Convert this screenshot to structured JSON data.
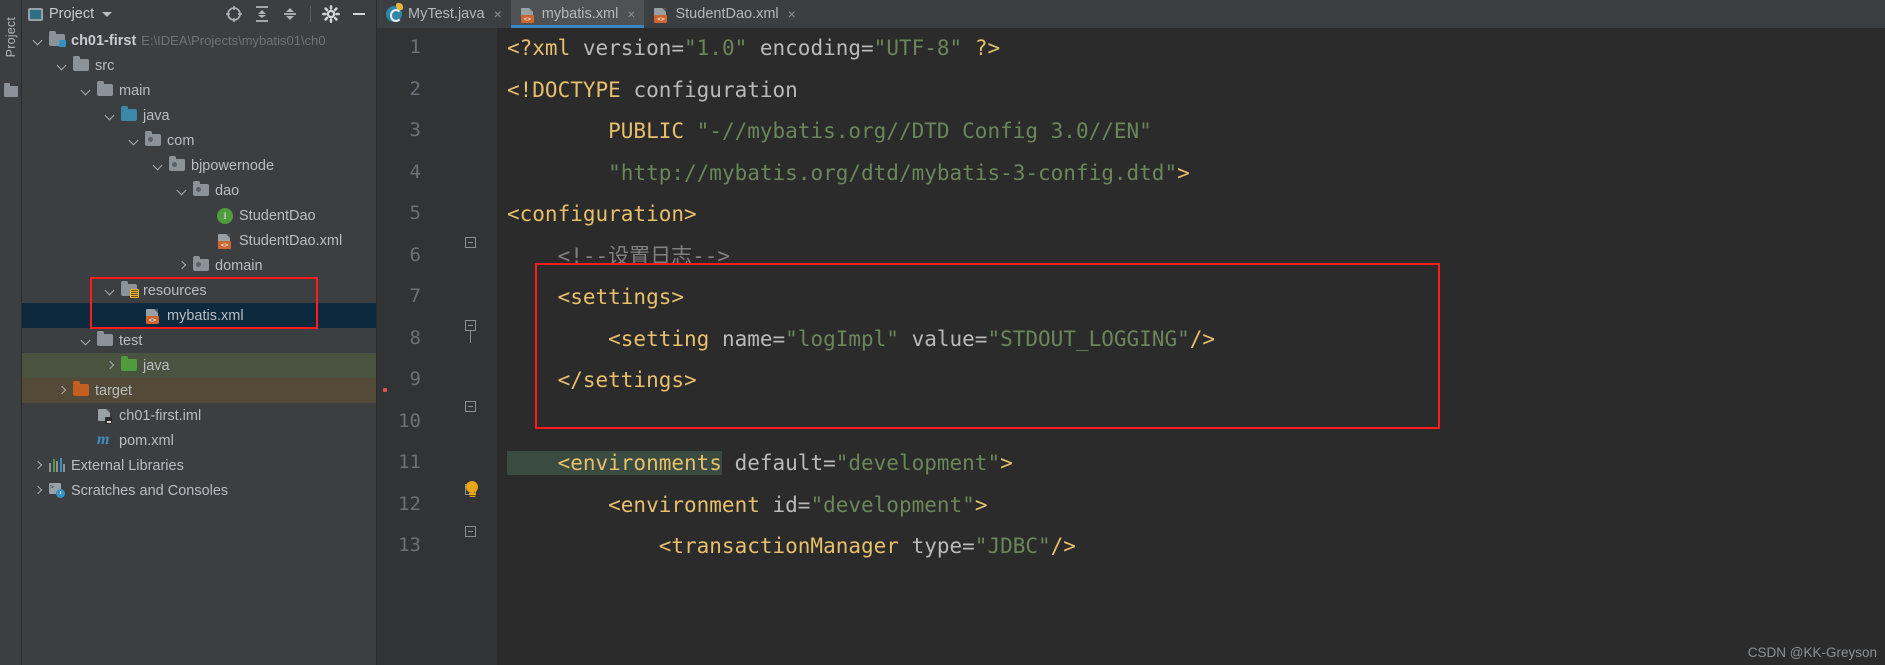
{
  "toolstrip": {
    "label": "Project",
    "folder_icon": "folder-icon"
  },
  "sidebar": {
    "header": {
      "title": "Project",
      "view_icon": "project-view-icon",
      "dropdown_icon": "chevron-down-icon",
      "locate_icon": "locate-target-icon",
      "expand_icon": "expand-all-icon",
      "collapse_icon": "collapse-all-icon",
      "settings_icon": "gear-icon",
      "hide_icon": "minimize-icon"
    },
    "tree": [
      {
        "label": "ch01-first",
        "path": "E:\\IDEA\\Projects\\mybatis01\\ch0",
        "icon": "module-folder-icon",
        "arrow": "down",
        "indent": 0,
        "bold": true
      },
      {
        "label": "src",
        "icon": "folder-icon",
        "arrow": "down",
        "indent": 1
      },
      {
        "label": "main",
        "icon": "folder-icon",
        "arrow": "down",
        "indent": 2
      },
      {
        "label": "java",
        "icon": "source-folder-icon",
        "arrow": "down",
        "indent": 3
      },
      {
        "label": "com",
        "icon": "package-icon",
        "arrow": "down",
        "indent": 4
      },
      {
        "label": "bjpowernode",
        "icon": "package-icon",
        "arrow": "down",
        "indent": 5
      },
      {
        "label": "dao",
        "icon": "package-icon",
        "arrow": "down",
        "indent": 6
      },
      {
        "label": "StudentDao",
        "icon": "interface-icon",
        "arrow": "none",
        "indent": 7
      },
      {
        "label": "StudentDao.xml",
        "icon": "xml-file-icon",
        "arrow": "none",
        "indent": 7
      },
      {
        "label": "domain",
        "icon": "package-icon",
        "arrow": "right",
        "indent": 6
      },
      {
        "label": "resources",
        "icon": "resources-folder-icon",
        "arrow": "down",
        "indent": 3
      },
      {
        "label": "mybatis.xml",
        "icon": "xml-file-icon",
        "arrow": "none",
        "indent": 4,
        "selected": true
      },
      {
        "label": "test",
        "icon": "folder-icon",
        "arrow": "down",
        "indent": 2
      },
      {
        "label": "java",
        "icon": "test-source-folder-icon",
        "arrow": "right",
        "indent": 3,
        "row_highlight": "green"
      },
      {
        "label": "target",
        "icon": "excluded-folder-icon",
        "arrow": "right",
        "indent": 1,
        "row_highlight": "brown"
      },
      {
        "label": "ch01-first.iml",
        "icon": "iml-file-icon",
        "arrow": "none",
        "indent": 2
      },
      {
        "label": "pom.xml",
        "icon": "maven-file-icon",
        "arrow": "none",
        "indent": 2
      },
      {
        "label": "External Libraries",
        "icon": "libraries-icon",
        "arrow": "right",
        "indent": 0
      },
      {
        "label": "Scratches and Consoles",
        "icon": "scratches-icon",
        "arrow": "right",
        "indent": 0
      }
    ],
    "highlight_note": "red annotation box around resources and mybatis.xml"
  },
  "tabs": [
    {
      "label": "MyTest.java",
      "icon": "java-class-icon",
      "active": false,
      "close_icon": "close-icon"
    },
    {
      "label": "mybatis.xml",
      "icon": "xml-file-icon",
      "active": true,
      "close_icon": "close-icon"
    },
    {
      "label": "StudentDao.xml",
      "icon": "xml-file-icon",
      "active": false,
      "close_icon": "close-icon"
    }
  ],
  "editor": {
    "line_numbers": [
      "1",
      "2",
      "3",
      "4",
      "5",
      "6",
      "7",
      "8",
      "9",
      "10",
      "11",
      "12",
      "13"
    ],
    "lines": [
      {
        "n": 1,
        "segments": [
          {
            "t": "<?xml ",
            "c": "tagc"
          },
          {
            "t": "version=",
            "c": "attr"
          },
          {
            "t": "\"1.0\"",
            "c": "str"
          },
          {
            "t": " encoding=",
            "c": "attr"
          },
          {
            "t": "\"UTF-8\"",
            "c": "str"
          },
          {
            "t": " ?>",
            "c": "tagc"
          }
        ]
      },
      {
        "n": 2,
        "segments": [
          {
            "t": "<!DOCTYPE ",
            "c": "tagc"
          },
          {
            "t": "configuration",
            "c": "attr"
          }
        ]
      },
      {
        "n": 3,
        "segments": [
          {
            "t": "        PUBLIC ",
            "c": "tagc"
          },
          {
            "t": "\"-//mybatis.org//DTD Config 3.0//EN\"",
            "c": "str"
          }
        ]
      },
      {
        "n": 4,
        "segments": [
          {
            "t": "        ",
            "c": "txt"
          },
          {
            "t": "\"http://mybatis.org/dtd/mybatis-3-config.dtd\"",
            "c": "str"
          },
          {
            "t": ">",
            "c": "tagc"
          }
        ]
      },
      {
        "n": 5,
        "segments": [
          {
            "t": "<configuration>",
            "c": "tagc"
          }
        ]
      },
      {
        "n": 6,
        "segments": [
          {
            "t": "    <!--设置日志-->",
            "c": "cmt"
          }
        ]
      },
      {
        "n": 7,
        "segments": [
          {
            "t": "    <settings>",
            "c": "tagc"
          }
        ]
      },
      {
        "n": 8,
        "segments": [
          {
            "t": "        <setting ",
            "c": "tagc"
          },
          {
            "t": "name=",
            "c": "attr"
          },
          {
            "t": "\"logImpl\"",
            "c": "str"
          },
          {
            "t": " value=",
            "c": "attr"
          },
          {
            "t": "\"STDOUT_LOGGING\"",
            "c": "str"
          },
          {
            "t": "/>",
            "c": "tagc"
          }
        ]
      },
      {
        "n": 9,
        "segments": [
          {
            "t": "    </settings>",
            "c": "tagc"
          }
        ]
      },
      {
        "n": 10,
        "segments": [
          {
            "t": "",
            "c": "txt"
          }
        ]
      },
      {
        "n": 11,
        "segments": [
          {
            "t": "    <environments",
            "c": "tagc",
            "hl": true
          },
          {
            "t": " default=",
            "c": "attr"
          },
          {
            "t": "\"development\"",
            "c": "str"
          },
          {
            "t": ">",
            "c": "tagc"
          }
        ]
      },
      {
        "n": 12,
        "segments": [
          {
            "t": "        <environment ",
            "c": "tagc"
          },
          {
            "t": "id=",
            "c": "attr"
          },
          {
            "t": "\"development\"",
            "c": "str"
          },
          {
            "t": ">",
            "c": "tagc"
          }
        ]
      },
      {
        "n": 13,
        "segments": [
          {
            "t": "            <transactionManager ",
            "c": "tagc"
          },
          {
            "t": "type=",
            "c": "attr"
          },
          {
            "t": "\"JDBC\"",
            "c": "str"
          },
          {
            "t": "/>",
            "c": "tagc"
          }
        ]
      }
    ],
    "gutter": {
      "bulb_icon": "intention-bulb-icon",
      "fold_icon": "code-fold-icon",
      "error_marker": "error-stripe-marker"
    },
    "annotation": {
      "color": "#ff1c1c",
      "note": "red box around settings block lines 6-9"
    }
  },
  "watermark": "CSDN @KK-Greyson",
  "colors": {
    "bg_editor": "#2b2b2b",
    "bg_panel": "#3c3f41",
    "accent_tab": "#3d86c6",
    "selection": "#0d293e",
    "annotation": "#ff1c1c",
    "tag": "#e8bf6a",
    "string": "#6a8759",
    "comment": "#808080"
  }
}
